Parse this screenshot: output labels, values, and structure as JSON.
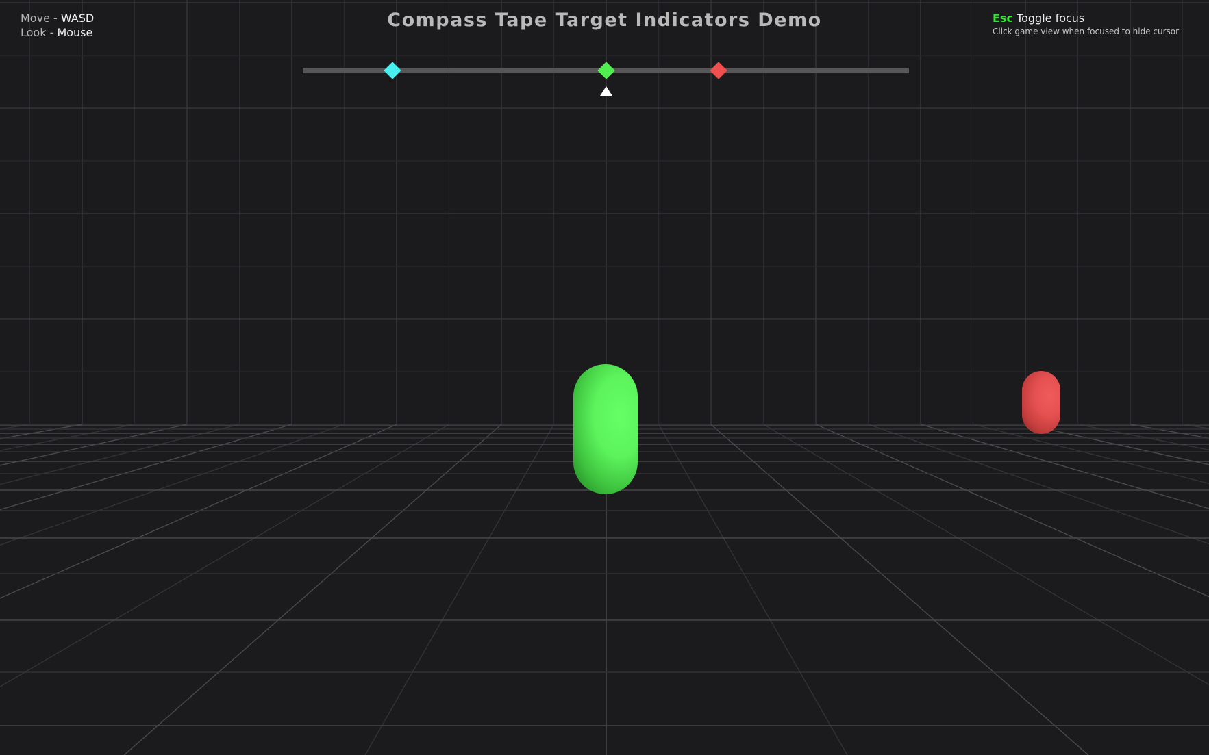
{
  "title": "Compass Tape Target Indicators Demo",
  "controls": {
    "move_label": "Move -",
    "move_key": "WASD",
    "look_label": "Look -",
    "look_key": "Mouse"
  },
  "focus_help": {
    "key": "Esc",
    "label": "Toggle focus",
    "hint": "Click game view when focused to hide cursor"
  },
  "compass": {
    "markers": [
      {
        "name": "cyan-target",
        "color": "#48f0f0",
        "position": 0.148
      },
      {
        "name": "green-target",
        "color": "#50ee50",
        "position": 0.5
      },
      {
        "name": "red-target",
        "color": "#f05050",
        "position": 0.686
      }
    ],
    "heading_pointer_color": "#ffffff"
  },
  "targets": [
    {
      "name": "green-capsule",
      "color": "#5cf35c"
    },
    {
      "name": "red-capsule",
      "color": "#e55050"
    }
  ]
}
